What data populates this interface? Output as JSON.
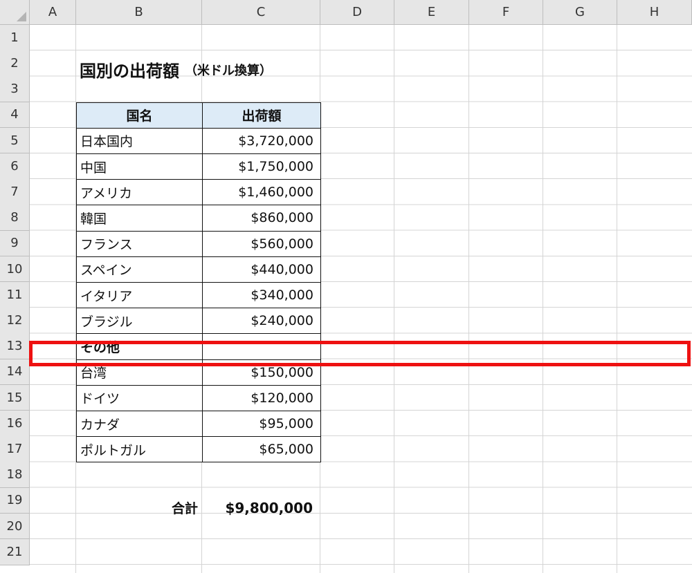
{
  "columns": [
    "A",
    "B",
    "C",
    "D",
    "E",
    "F",
    "G",
    "H"
  ],
  "rows": [
    "1",
    "2",
    "3",
    "4",
    "5",
    "6",
    "7",
    "8",
    "9",
    "10",
    "11",
    "12",
    "13",
    "14",
    "15",
    "16",
    "17",
    "18",
    "19",
    "20",
    "21"
  ],
  "title": {
    "main": "国別の出荷額",
    "sub": "（米ドル換算）"
  },
  "table": {
    "headers": [
      "国名",
      "出荷額"
    ],
    "rows": [
      {
        "name": "日本国内",
        "value": "$3,720,000"
      },
      {
        "name": "中国",
        "value": "$1,750,000"
      },
      {
        "name": "アメリカ",
        "value": "$1,460,000"
      },
      {
        "name": "韓国",
        "value": "$860,000"
      },
      {
        "name": "フランス",
        "value": "$560,000"
      },
      {
        "name": "スペイン",
        "value": "$440,000"
      },
      {
        "name": "イタリア",
        "value": "$340,000"
      },
      {
        "name": "ブラジル",
        "value": "$240,000"
      },
      {
        "name": "その他",
        "value": ""
      },
      {
        "name": "台湾",
        "value": "$150,000"
      },
      {
        "name": "ドイツ",
        "value": "$120,000"
      },
      {
        "name": "カナダ",
        "value": "$95,000"
      },
      {
        "name": "ポルトガル",
        "value": "$65,000"
      }
    ]
  },
  "total": {
    "label": "合計",
    "value": "$9,800,000"
  },
  "colors": {
    "header_fill": "#ddebf7",
    "highlight": "#ee1111",
    "grid": "#d4d4d4",
    "headers_bg": "#e6e6e6"
  }
}
